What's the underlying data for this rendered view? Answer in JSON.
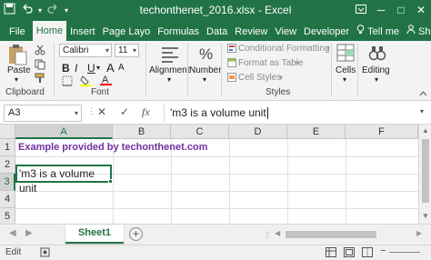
{
  "window": {
    "title": "techonthenet_2016.xlsx - Excel",
    "accent_color": "#217346"
  },
  "qat": {
    "save_icon": "save-icon",
    "undo_icon": "undo-icon",
    "redo_icon": "redo-icon",
    "customize_icon": "chevron-down-icon"
  },
  "tabs": {
    "file": "File",
    "home": "Home",
    "insert": "Insert",
    "page_layout": "Page Layo",
    "formulas": "Formulas",
    "data": "Data",
    "review": "Review",
    "view": "View",
    "developer": "Developer",
    "tell_me": "Tell me",
    "share": "Share"
  },
  "ribbon": {
    "paste_label": "Paste",
    "clipboard_label": "Clipboard",
    "font_name": "Calibri",
    "font_size": "11",
    "bold": "B",
    "italic": "I",
    "underline": "U",
    "font_label": "Font",
    "alignment_label": "Alignment",
    "number_label": "Number",
    "conditional_formatting": "Conditional Formatting",
    "format_as_table": "Format as Table",
    "cell_styles": "Cell Styles",
    "styles_label": "Styles",
    "cells_label": "Cells",
    "editing_label": "Editing",
    "grow_font": "A",
    "shrink_font": "A"
  },
  "formula_bar": {
    "name_box": "A3",
    "cancel": "✕",
    "enter": "✓",
    "fx": "fx",
    "content": "'m3 is a volume unit"
  },
  "grid": {
    "columns": [
      "A",
      "B",
      "C",
      "D",
      "E",
      "F"
    ],
    "rows": [
      "1",
      "2",
      "3",
      "4",
      "5"
    ],
    "cells": {
      "B1": "Example provided by techonthenet.com",
      "A3": "'m3 is a volume unit"
    }
  },
  "sheets": {
    "active": "Sheet1",
    "add": "+"
  },
  "status": {
    "mode": "Edit"
  }
}
